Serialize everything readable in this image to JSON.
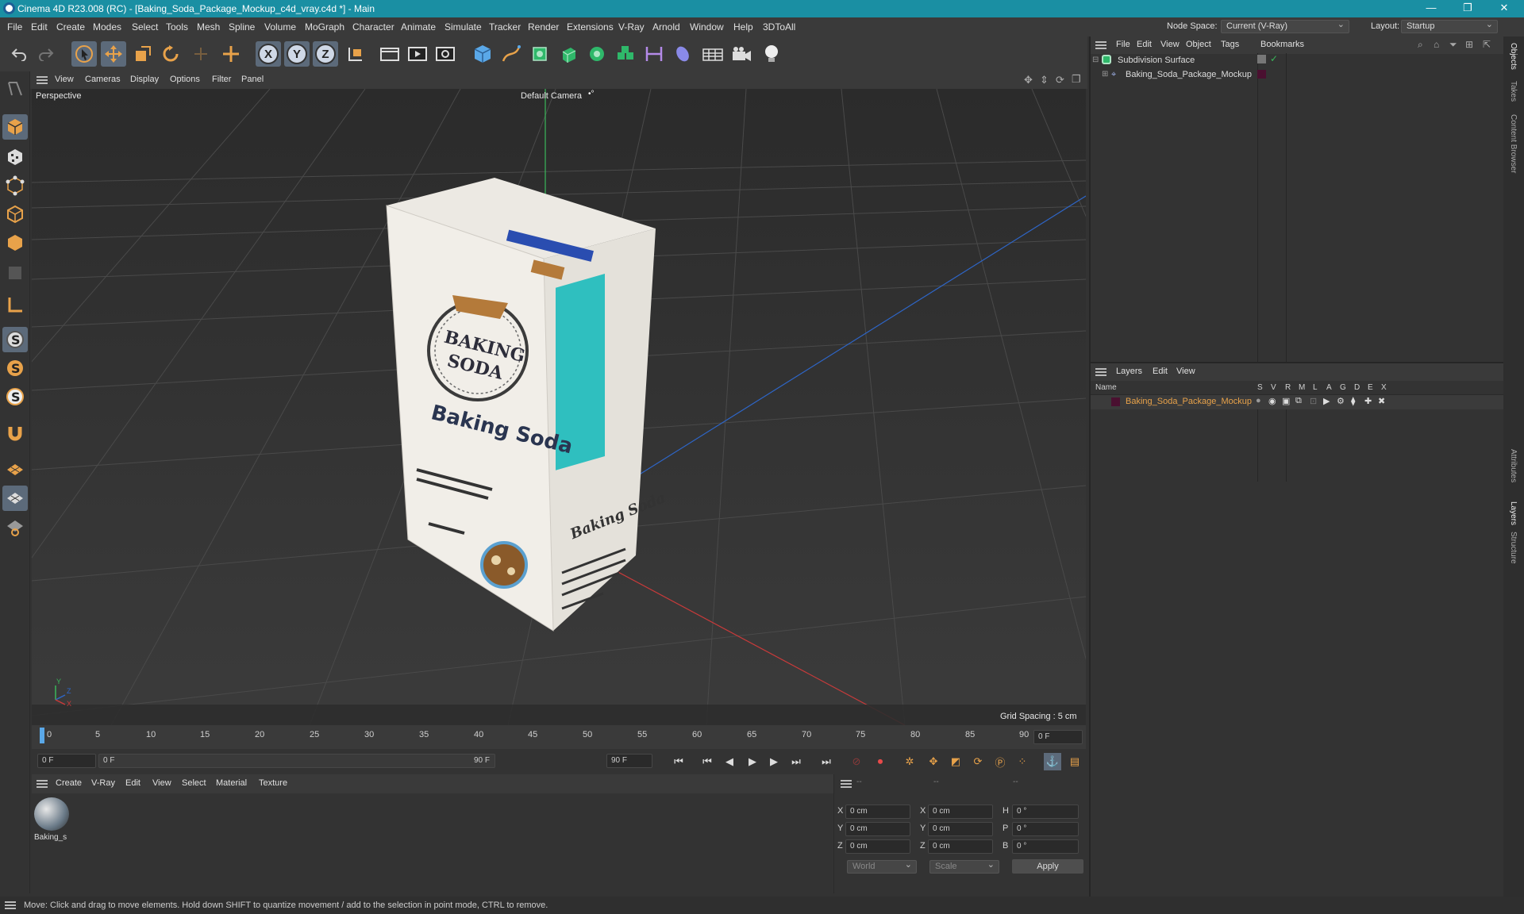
{
  "window": {
    "title": "Cinema 4D R23.008 (RC) - [Baking_Soda_Package_Mockup_c4d_vray.c4d *] - Main"
  },
  "menubar": {
    "items": [
      "File",
      "Edit",
      "Create",
      "Modes",
      "Select",
      "Tools",
      "Mesh",
      "Spline",
      "Volume",
      "MoGraph",
      "Character",
      "Animate",
      "Simulate",
      "Tracker",
      "Render",
      "Extensions",
      "V-Ray",
      "Arnold",
      "Window",
      "Help",
      "3DToAll"
    ],
    "node_space_label": "Node Space:",
    "node_space_value": "Current (V-Ray)",
    "layout_label": "Layout:",
    "layout_value": "Startup"
  },
  "toolbar": {
    "axis_x": "X",
    "axis_y": "Y",
    "axis_z": "Z"
  },
  "viewport_menu": {
    "items": [
      "View",
      "Cameras",
      "Display",
      "Options",
      "Filter",
      "Panel"
    ]
  },
  "viewport": {
    "view_name": "Perspective",
    "camera_label": "Default Camera",
    "grid_spacing": "Grid Spacing : 5 cm",
    "axis_y": "Y",
    "axis_z": "Z",
    "axis_x": "X",
    "package": {
      "logo_line1": "BAKING",
      "logo_line2": "SODA",
      "product_name": "Baking Soda",
      "side_brand": "Baking Soda"
    }
  },
  "timeline": {
    "ticks": [
      "0",
      "5",
      "10",
      "15",
      "20",
      "25",
      "30",
      "35",
      "40",
      "45",
      "50",
      "55",
      "60",
      "65",
      "70",
      "75",
      "80",
      "85",
      "90"
    ],
    "current_frame": "0 F"
  },
  "transport": {
    "start": "0 F",
    "range_start": "0 F",
    "range_end": "90 F",
    "end": "90 F"
  },
  "material_menu": {
    "items": [
      "Create",
      "V-Ray",
      "Edit",
      "View",
      "Select",
      "Material",
      "Texture"
    ]
  },
  "materials": [
    {
      "name": "Baking_s"
    }
  ],
  "coords": {
    "header": [
      "--",
      "--",
      "--"
    ],
    "rows": [
      {
        "a": "X",
        "av": "0 cm",
        "b": "X",
        "bv": "0 cm",
        "c": "H",
        "cv": "0 °"
      },
      {
        "a": "Y",
        "av": "0 cm",
        "b": "Y",
        "bv": "0 cm",
        "c": "P",
        "cv": "0 °"
      },
      {
        "a": "Z",
        "av": "0 cm",
        "b": "Z",
        "bv": "0 cm",
        "c": "B",
        "cv": "0 °"
      }
    ],
    "space": "World",
    "mode": "Scale",
    "apply": "Apply"
  },
  "objects_menu": {
    "items": [
      "File",
      "Edit",
      "View",
      "Object",
      "Tags",
      "Bookmarks"
    ]
  },
  "objects": [
    {
      "name": "Subdivision Surface"
    },
    {
      "name": "Baking_Soda_Package_Mockup"
    }
  ],
  "layers_menu": {
    "items": [
      "Layers",
      "Edit",
      "View"
    ]
  },
  "layers": {
    "name_header": "Name",
    "columns": [
      "S",
      "V",
      "R",
      "M",
      "L",
      "A",
      "G",
      "D",
      "E",
      "X"
    ],
    "rows": [
      {
        "name": "Baking_Soda_Package_Mockup",
        "color": "#4a1030"
      }
    ]
  },
  "right_tabs": [
    "Objects",
    "Takes",
    "Content Browser",
    "Attributes",
    "Layers",
    "Structure"
  ],
  "status": "Move: Click and drag to move elements. Hold down SHIFT to quantize movement / add to the selection in point mode, CTRL to remove."
}
